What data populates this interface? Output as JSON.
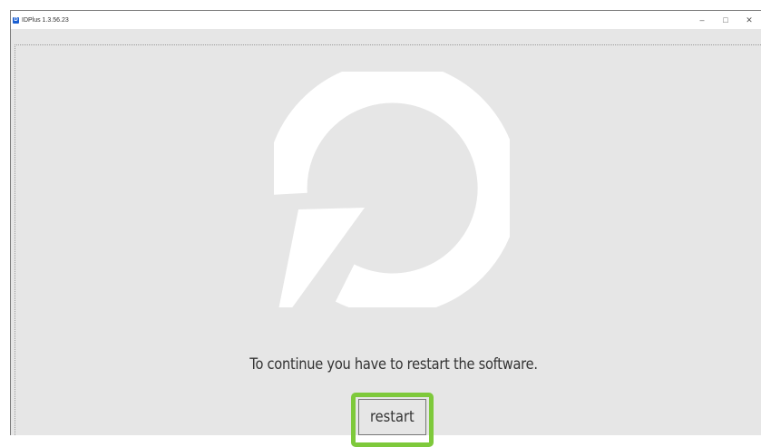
{
  "window": {
    "title": "IDPlus 1.3.56.23",
    "controls": {
      "minimize": "–",
      "maximize": "□",
      "close": "✕"
    }
  },
  "main": {
    "message": "To continue you have to restart the software.",
    "restart_label": "restart",
    "icon": "restart-icon"
  },
  "colors": {
    "background": "#e6e6e6",
    "icon_fill": "#ffffff",
    "highlight": "#7ec93b"
  }
}
